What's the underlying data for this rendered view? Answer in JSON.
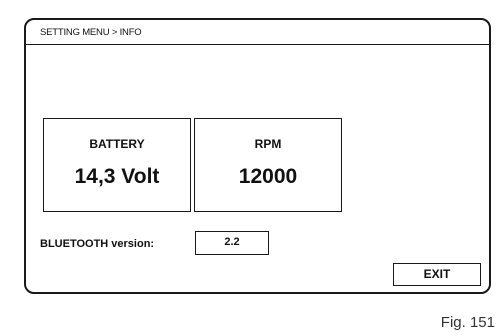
{
  "header": {
    "breadcrumb": "SETTING MENU > INFO"
  },
  "battery": {
    "label": "BATTERY",
    "value": "14,3 Volt"
  },
  "rpm": {
    "label": "RPM",
    "value": "12000"
  },
  "bluetooth": {
    "label": "BLUETOOTH version:",
    "value": "2.2"
  },
  "buttons": {
    "exit_label": "EXIT"
  },
  "figure": {
    "caption": "Fig. 151"
  }
}
